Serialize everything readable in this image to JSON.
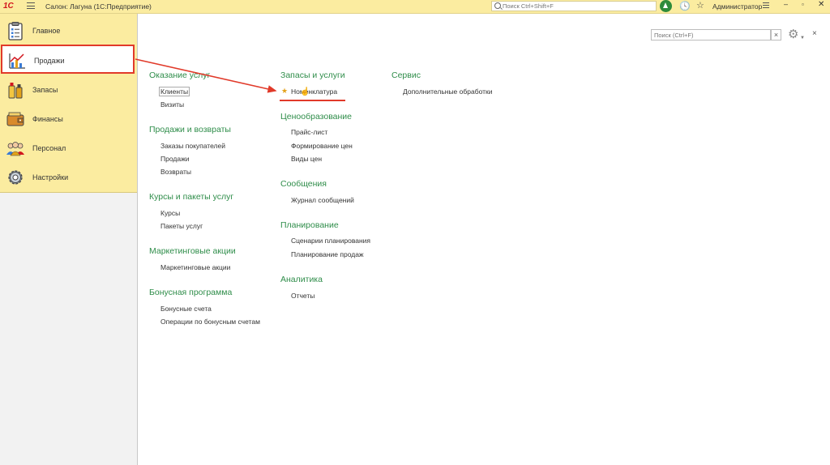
{
  "titlebar": {
    "logo": "1С",
    "title": "Салон: Лагуна  (1С:Предприятие)",
    "search_placeholder": "Поиск Ctrl+Shift+F",
    "user": "Администратор",
    "minimize": "–",
    "maximize": "▫",
    "close": "✕"
  },
  "sidebar": {
    "items": [
      {
        "label": "Главное",
        "icon": "clipboard-icon"
      },
      {
        "label": "Продажи",
        "icon": "sales-chart-icon"
      },
      {
        "label": "Запасы",
        "icon": "stock-bottles-icon"
      },
      {
        "label": "Финансы",
        "icon": "wallet-icon"
      },
      {
        "label": "Персонал",
        "icon": "people-icon"
      },
      {
        "label": "Настройки",
        "icon": "gear-icon"
      }
    ],
    "selected": "Продажи"
  },
  "panel": {
    "search_placeholder": "Поиск (Ctrl+F)",
    "clear": "×",
    "close": "×",
    "col1": {
      "s1": {
        "title": "Оказание услуг",
        "links": [
          "Клиенты",
          "Визиты"
        ]
      },
      "s2": {
        "title": "Продажи и возвраты",
        "links": [
          "Заказы покупателей",
          "Продажи",
          "Возвраты"
        ]
      },
      "s3": {
        "title": "Курсы и пакеты услуг",
        "links": [
          "Курсы",
          "Пакеты услуг"
        ]
      },
      "s4": {
        "title": "Маркетинговые акции",
        "links": [
          "Маркетинговые акции"
        ]
      },
      "s5": {
        "title": "Бонусная программа",
        "links": [
          "Бонусные счета",
          "Операции по бонусным счетам"
        ]
      }
    },
    "col2": {
      "s1": {
        "title": "Запасы и услуги",
        "links": [
          "Номенклатура"
        ]
      },
      "s2": {
        "title": "Ценообразование",
        "links": [
          "Прайс-лист",
          "Формирование цен",
          "Виды цен"
        ]
      },
      "s3": {
        "title": "Сообщения",
        "links": [
          "Журнал сообщений"
        ]
      },
      "s4": {
        "title": "Планирование",
        "links": [
          "Сценарии планирования",
          "Планирование продаж"
        ]
      },
      "s5": {
        "title": "Аналитика",
        "links": [
          "Отчеты"
        ]
      }
    },
    "col3": {
      "s1": {
        "title": "Сервис",
        "links": [
          "Дополнительные обработки"
        ]
      }
    }
  },
  "colors": {
    "accent_green": "#2f8d4a",
    "highlight_red": "#e13a2a",
    "panel_yellow": "#fbeca0"
  }
}
